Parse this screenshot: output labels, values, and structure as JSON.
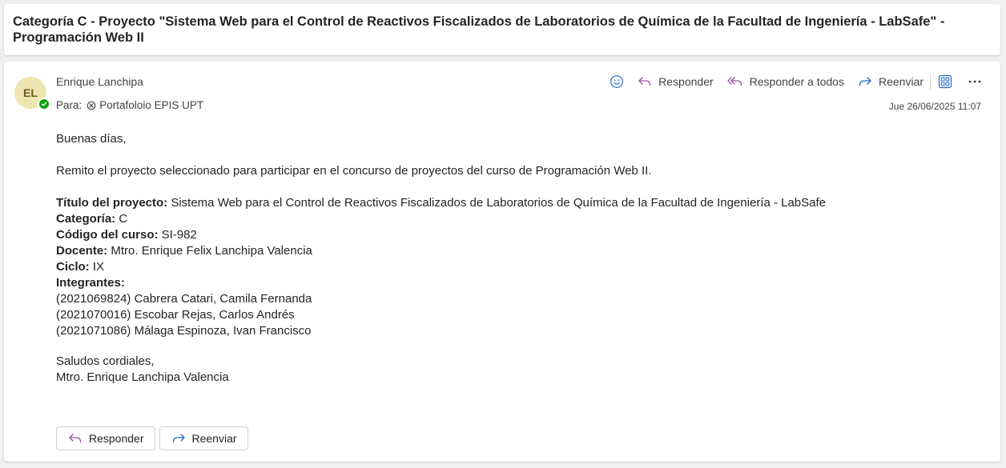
{
  "subject": "Categoría C - Proyecto \"Sistema Web para el Control de Reactivos Fiscalizados de Laboratorios de Química de la Facultad de Ingeniería - LabSafe\" - Programación Web II",
  "message": {
    "avatar_initials": "EL",
    "sender": "Enrique Lanchipa",
    "to_label": "Para:",
    "recipient": "Portafoloio EPIS UPT",
    "date": "Jue 26/06/2025 11:07"
  },
  "toolbar": {
    "reply": "Responder",
    "reply_all": "Responder a todos",
    "forward": "Reenviar"
  },
  "body": {
    "greeting": "Buenas días,",
    "intro": "Remito el proyecto seleccionado para participar en el concurso de proyectos del curso de Programación Web II.",
    "fields": [
      {
        "label": "Título del proyecto:",
        "value": " Sistema Web para el Control de Reactivos Fiscalizados de Laboratorios de Química de la Facultad de Ingeniería -  LabSafe"
      },
      {
        "label": "Categoría:",
        "value": " C"
      },
      {
        "label": "Código del curso:",
        "value": " SI-982"
      },
      {
        "label": "Docente:",
        "value": " Mtro. Enrique Felix Lanchipa Valencia"
      },
      {
        "label": "Ciclo:",
        "value": " IX"
      },
      {
        "label": "Integrantes:",
        "value": ""
      }
    ],
    "members": [
      "(2021069824) Cabrera Catari, Camila Fernanda",
      "(2021070016) Escobar Rejas, Carlos Andrés",
      "(2021071086) Málaga Espinoza, Ivan Francisco"
    ],
    "closing": "Saludos cordiales,",
    "signature": "Mtro. Enrique Lanchipa Valencia"
  },
  "footer": {
    "reply": "Responder",
    "forward": "Reenviar"
  },
  "colors": {
    "reply_icon": "#a04ea8",
    "forward_icon": "#1a6fc4",
    "toolbar_icon": "#2b6cc4",
    "avatar_bg": "#eee6b2",
    "presence": "#13a10e"
  }
}
